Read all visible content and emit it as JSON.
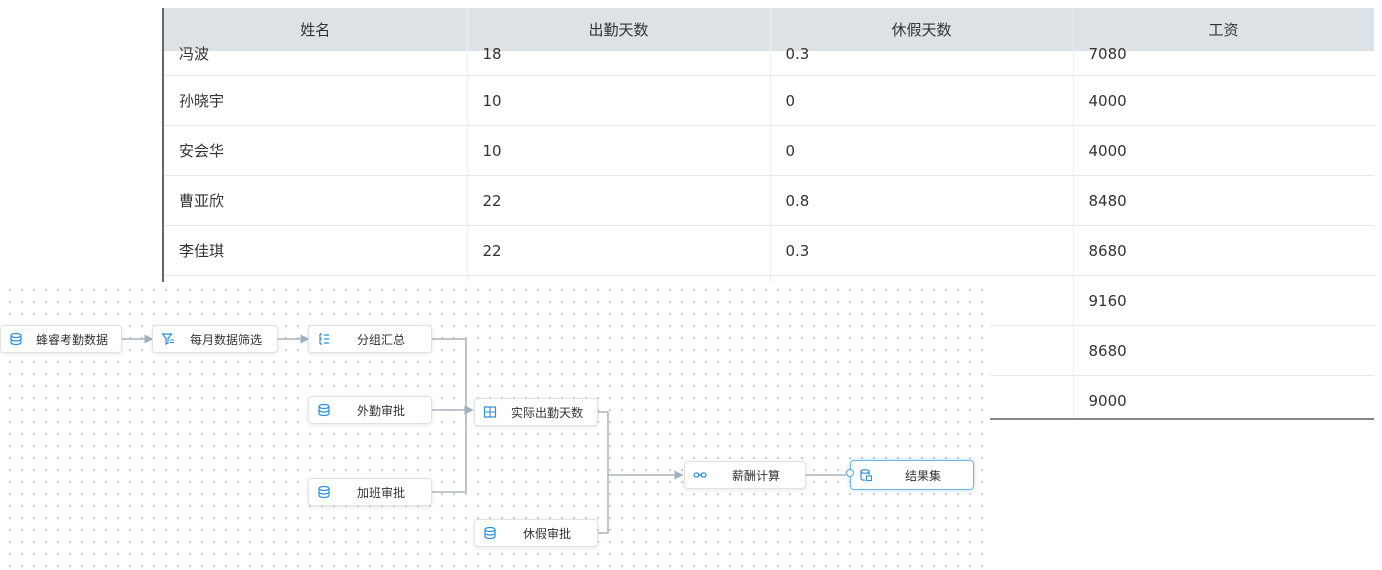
{
  "table": {
    "columns": [
      "姓名",
      "出勤天数",
      "休假天数",
      "工资"
    ],
    "rows": [
      [
        "冯波",
        "18",
        "0.3",
        "7080"
      ],
      [
        "孙晓宇",
        "10",
        "0",
        "4000"
      ],
      [
        "安会华",
        "10",
        "0",
        "4000"
      ],
      [
        "曹亚欣",
        "22",
        "0.8",
        "8480"
      ],
      [
        "李佳琪",
        "22",
        "0.3",
        "8680"
      ],
      [
        "",
        "",
        "",
        "9160"
      ],
      [
        "",
        "",
        "",
        "8680"
      ],
      [
        "",
        "",
        "",
        "9000"
      ]
    ]
  },
  "flow": {
    "nodes": {
      "source": {
        "label": "蜂睿考勤数据",
        "icon": "database-icon"
      },
      "filter": {
        "label": "每月数据筛选",
        "icon": "filter-icon"
      },
      "group": {
        "label": "分组汇总",
        "icon": "group-icon"
      },
      "field_approval": {
        "label": "外勤审批",
        "icon": "database-icon"
      },
      "overtime_approval": {
        "label": "加班审批",
        "icon": "database-icon"
      },
      "actual_days": {
        "label": "实际出勤天数",
        "icon": "join-icon"
      },
      "leave_approval": {
        "label": "休假审批",
        "icon": "database-icon"
      },
      "salary_calc": {
        "label": "薪酬计算",
        "icon": "link-icon"
      },
      "result": {
        "label": "结果集",
        "icon": "result-icon"
      }
    }
  },
  "colors": {
    "accent": "#2f8fd8",
    "header_bg": "#dde2e6",
    "edge": "#aab4be"
  }
}
